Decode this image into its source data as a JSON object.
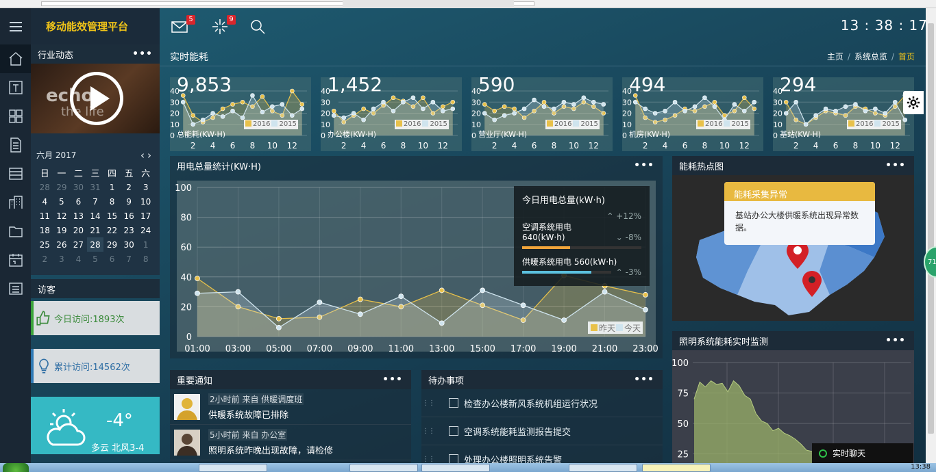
{
  "app": {
    "title": "移动能效管理平台"
  },
  "header": {
    "mail_badge": "5",
    "alert_badge": "9",
    "clock": "13 : 38 : 17"
  },
  "sidebar": {
    "news_title": "行业动态",
    "video_text_1": "echo",
    "video_text_2": "the life",
    "calendar": {
      "title": "六月 2017",
      "dow": [
        "日",
        "一",
        "二",
        "三",
        "四",
        "五",
        "六"
      ],
      "weeks": [
        [
          [
            "28",
            1
          ],
          [
            "29",
            1
          ],
          [
            "30",
            1
          ],
          [
            "31",
            1
          ],
          [
            "1",
            0
          ],
          [
            "2",
            0
          ],
          [
            "3",
            0
          ]
        ],
        [
          [
            "4",
            0
          ],
          [
            "5",
            0
          ],
          [
            "6",
            0
          ],
          [
            "7",
            0
          ],
          [
            "8",
            0
          ],
          [
            "9",
            0
          ],
          [
            "10",
            0
          ]
        ],
        [
          [
            "11",
            0
          ],
          [
            "12",
            0
          ],
          [
            "13",
            0
          ],
          [
            "14",
            0
          ],
          [
            "15",
            0
          ],
          [
            "16",
            0
          ],
          [
            "17",
            0
          ]
        ],
        [
          [
            "18",
            0
          ],
          [
            "19",
            0
          ],
          [
            "20",
            0
          ],
          [
            "21",
            0
          ],
          [
            "22",
            0
          ],
          [
            "23",
            0
          ],
          [
            "24",
            0
          ]
        ],
        [
          [
            "25",
            0
          ],
          [
            "26",
            0
          ],
          [
            "27",
            0
          ],
          [
            "28",
            2
          ],
          [
            "29",
            0
          ],
          [
            "30",
            0
          ],
          [
            "1",
            1
          ]
        ],
        [
          [
            "2",
            1
          ],
          [
            "3",
            1
          ],
          [
            "4",
            1
          ],
          [
            "5",
            1
          ],
          [
            "6",
            1
          ],
          [
            "7",
            1
          ],
          [
            "8",
            1
          ]
        ]
      ]
    },
    "visitors_title": "访客",
    "today_visits": "今日访问:1893次",
    "total_visits": "累计访问:14562次",
    "weather": {
      "temp": "-4°",
      "wind": "多云 北风3-4"
    }
  },
  "page": {
    "title": "实时能耗",
    "breadcrumb": [
      "主页",
      "系统总览",
      "首页"
    ]
  },
  "mini_cards": [
    {
      "value": "9,853",
      "label": "总能耗(KW·H)"
    },
    {
      "value": "1,452",
      "label": "办公楼(KW·H)"
    },
    {
      "value": "590",
      "label": "营业厅(KW·H)"
    },
    {
      "value": "494",
      "label": "机房(KW·H)"
    },
    {
      "value": "294",
      "label": "基站(KW·H)"
    }
  ],
  "mini_legend": [
    "2016",
    "2015"
  ],
  "panels": {
    "usage_title": "用电总量统计(KW·H)",
    "hotspot_title": "能耗热点图",
    "lighting_title": "照明系统能耗实时监测",
    "notice_title": "重要通知",
    "todo_title": "待办事项"
  },
  "tooltip": {
    "title": "今日用电总量(kW·h)",
    "total_change": "+12%",
    "ac_label": "空调系统用电",
    "ac_value": "640(kW·h)",
    "ac_change": "-8%",
    "heat_label": "供暖系统用电 560(kW·h)",
    "heat_change": "-3%"
  },
  "hotspot": {
    "popup_title": "能耗采集异常",
    "popup_text": "基站办公大楼供暖系统出现异常数据。"
  },
  "notices": [
    {
      "meta": "2小时前 来自 供暖调度班",
      "msg": "供暖系统故障已排除"
    },
    {
      "meta": "5小时前 来自 办公室",
      "msg": "照明系统昨晚出现故障，请检修"
    }
  ],
  "todos": [
    "检查办公楼新风系统机组运行状况",
    "空调系统能耗监测报告提交",
    "处理办公楼照明系统告警"
  ],
  "chat_label": "实时聊天",
  "float_ball": "71",
  "taskbar_time": "13:38",
  "colors": {
    "accent_yellow": "#f0c419",
    "series_today": "#cfe4ee",
    "series_yesterday": "#e8c14a"
  },
  "chart_data": [
    {
      "type": "line",
      "title": "用电总量统计(KW·H)",
      "categories": [
        "01:00",
        "03:00",
        "05:00",
        "07:00",
        "09:00",
        "11:00",
        "13:00",
        "15:00",
        "17:00",
        "19:00",
        "21:00",
        "23:00"
      ],
      "series": [
        {
          "name": "昨天",
          "values": [
            39,
            20,
            12,
            13,
            25,
            20,
            31,
            21,
            11,
            41,
            34,
            28
          ]
        },
        {
          "name": "今天",
          "values": [
            29,
            30,
            6,
            23,
            15,
            27,
            9,
            31,
            21,
            11,
            30,
            18
          ]
        }
      ],
      "ylim": [
        0,
        100
      ],
      "yticks": [
        0,
        20,
        40,
        60,
        80,
        100
      ],
      "grid": true,
      "legend": "bottom-right"
    },
    {
      "type": "line",
      "title": "照明系统能耗实时监测",
      "yticks": [
        25,
        50,
        75,
        100
      ],
      "ylim": [
        0,
        100
      ],
      "series": [
        {
          "values": [
            70,
            84,
            80,
            85,
            82,
            83,
            76,
            85,
            81,
            73,
            70,
            58,
            52,
            50,
            44,
            46,
            42,
            40,
            37,
            33,
            28,
            27,
            25,
            24,
            22,
            21,
            20,
            19,
            18,
            17,
            16,
            15,
            17,
            15,
            14,
            13,
            12,
            11,
            10
          ]
        }
      ]
    },
    {
      "type": "line",
      "title": "总能耗(KW·H)",
      "x": [
        1,
        2,
        3,
        4,
        5,
        6,
        7,
        8,
        9,
        10,
        11,
        12,
        13
      ],
      "xticks": [
        2,
        4,
        6,
        8,
        10,
        12
      ],
      "yticks": [
        0,
        10,
        20,
        30,
        40
      ],
      "series": [
        {
          "name": "2016",
          "values": [
            36,
            18,
            12,
            16,
            24,
            28,
            30,
            26,
            35,
            22,
            18,
            40,
            28
          ]
        },
        {
          "name": "2015",
          "values": [
            30,
            10,
            14,
            20,
            17,
            22,
            16,
            36,
            21,
            26,
            28,
            18,
            24
          ]
        }
      ]
    },
    {
      "type": "line",
      "title": "办公楼(KW·H)",
      "x": [
        1,
        2,
        3,
        4,
        5,
        6,
        7,
        8,
        9,
        10,
        11,
        12,
        13
      ],
      "xticks": [
        2,
        4,
        6,
        8,
        10,
        12
      ],
      "yticks": [
        0,
        10,
        20,
        30,
        40
      ],
      "series": [
        {
          "name": "2016",
          "values": [
            22,
            12,
            18,
            24,
            20,
            27,
            34,
            31,
            26,
            34,
            20,
            26,
            30
          ]
        },
        {
          "name": "2015",
          "values": [
            18,
            16,
            20,
            14,
            24,
            30,
            22,
            30,
            34,
            24,
            30,
            22,
            24
          ]
        }
      ]
    },
    {
      "type": "line",
      "title": "营业厅(KW·H)",
      "x": [
        1,
        2,
        3,
        4,
        5,
        6,
        7,
        8,
        9,
        10,
        11,
        12,
        13
      ],
      "xticks": [
        2,
        4,
        6,
        8,
        10,
        12
      ],
      "yticks": [
        0,
        10,
        20,
        30,
        40
      ],
      "series": [
        {
          "name": "2016",
          "values": [
            28,
            22,
            26,
            24,
            16,
            22,
            30,
            20,
            26,
            24,
            30,
            26,
            20
          ]
        },
        {
          "name": "2015",
          "values": [
            20,
            14,
            18,
            20,
            24,
            32,
            26,
            24,
            30,
            28,
            34,
            30,
            28
          ]
        }
      ]
    },
    {
      "type": "line",
      "title": "机房(KW·H)",
      "x": [
        1,
        2,
        3,
        4,
        5,
        6,
        7,
        8,
        9,
        10,
        11,
        12,
        13
      ],
      "xticks": [
        2,
        4,
        6,
        8,
        10,
        12
      ],
      "yticks": [
        0,
        10,
        20,
        30,
        40
      ],
      "series": [
        {
          "name": "2016",
          "values": [
            36,
            16,
            12,
            14,
            18,
            24,
            22,
            26,
            30,
            18,
            22,
            34,
            24
          ]
        },
        {
          "name": "2015",
          "values": [
            30,
            24,
            20,
            22,
            30,
            22,
            26,
            34,
            26,
            14,
            28,
            22,
            30
          ]
        }
      ]
    },
    {
      "type": "line",
      "title": "基站(KW·H)",
      "x": [
        1,
        2,
        3,
        4,
        5,
        6,
        7,
        8,
        9,
        10,
        11,
        12,
        13
      ],
      "xticks": [
        2,
        4,
        6,
        8,
        10,
        12
      ],
      "yticks": [
        0,
        10,
        20,
        30,
        40
      ],
      "series": [
        {
          "name": "2016",
          "values": [
            30,
            14,
            10,
            16,
            22,
            20,
            18,
            26,
            24,
            20,
            18,
            26,
            36
          ]
        },
        {
          "name": "2015",
          "values": [
            20,
            30,
            10,
            18,
            24,
            22,
            26,
            28,
            22,
            24,
            20,
            30,
            14
          ]
        }
      ]
    }
  ]
}
